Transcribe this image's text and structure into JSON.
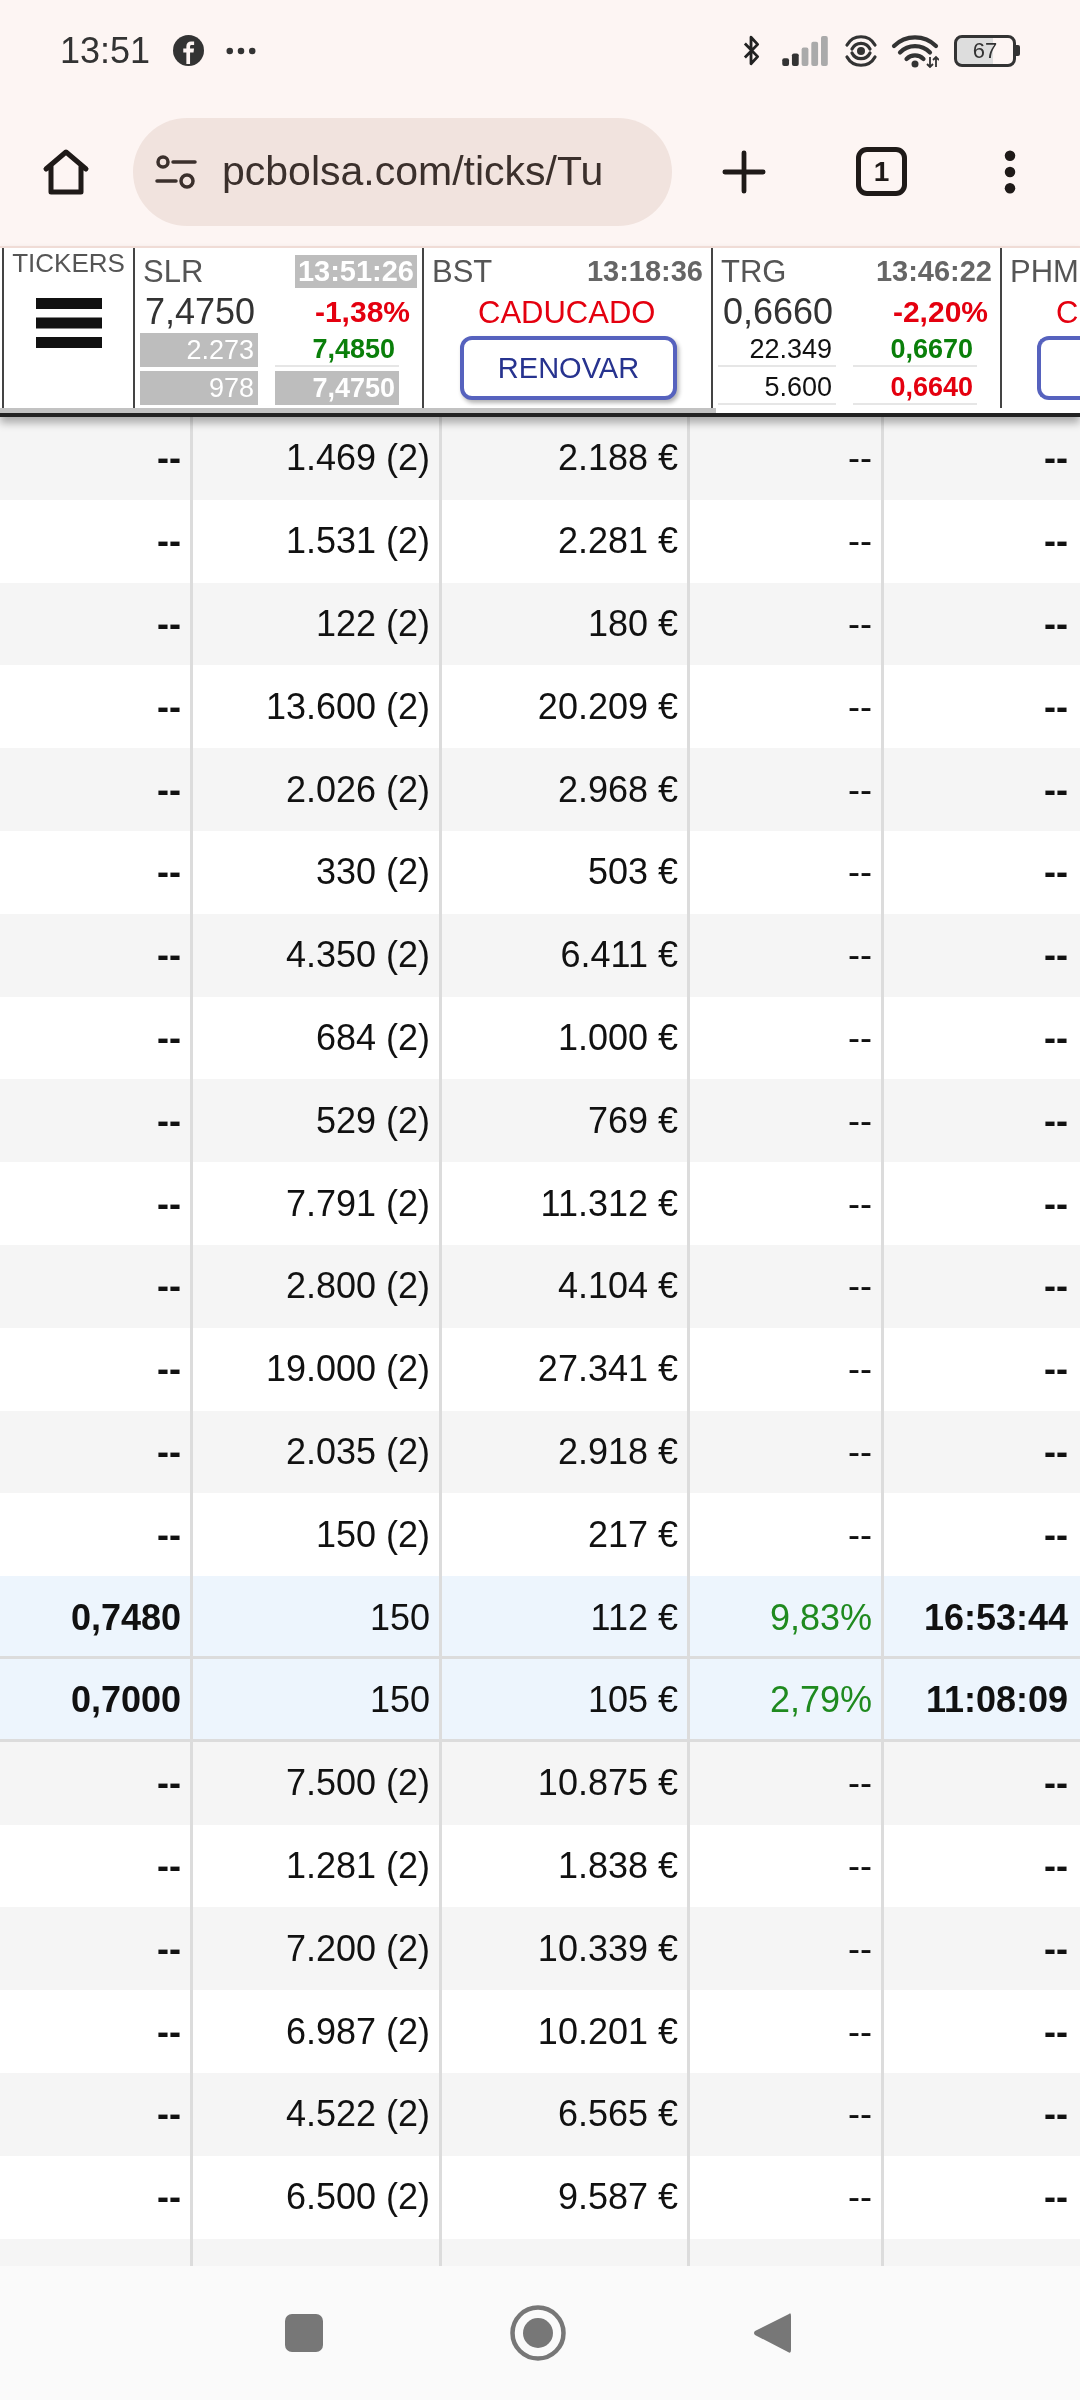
{
  "status_bar": {
    "time": "13:51",
    "battery": "67"
  },
  "browser": {
    "url": "pcbolsa.com/ticks/Tu",
    "tab_count": "1"
  },
  "ticker_panel": {
    "menu_label": "TICKERS",
    "tickers": [
      {
        "kind": "quote",
        "symbol": "SLR",
        "time": "13:51:26",
        "time_flash": true,
        "price": "7,4750",
        "change": "-1,38%",
        "rising": false,
        "bid_volume": {
          "text": "2.273",
          "flash": true
        },
        "bid": {
          "text": "7,4850",
          "flash": false
        },
        "ask_volume": {
          "text": "978",
          "flash": true
        },
        "ask": {
          "text": "7,4750",
          "flash": true
        }
      },
      {
        "kind": "expired",
        "symbol": "BST",
        "time": "13:18:36",
        "time_flash": false,
        "status": "CADUCADO",
        "button": "RENOVAR"
      },
      {
        "kind": "quote",
        "symbol": "TRG",
        "time": "13:46:22",
        "time_flash": false,
        "price": "0,6660",
        "change": "-2,20%",
        "rising": false,
        "bid_volume": {
          "text": "22.349",
          "flash": false
        },
        "bid": {
          "text": "0,6670",
          "flash": false
        },
        "ask_volume": {
          "text": "5.600",
          "flash": false
        },
        "ask": {
          "text": "0,6640",
          "flash": false
        }
      },
      {
        "kind": "expired",
        "symbol": "PHM",
        "status": "C"
      }
    ]
  },
  "table": {
    "rows": [
      {
        "cells": [
          "--",
          "1.469 (2)",
          "2.188 €",
          "--",
          "--"
        ],
        "highlighted": false
      },
      {
        "cells": [
          "--",
          "1.531 (2)",
          "2.281 €",
          "--",
          "--"
        ],
        "highlighted": false
      },
      {
        "cells": [
          "--",
          "122 (2)",
          "180 €",
          "--",
          "--"
        ],
        "highlighted": false
      },
      {
        "cells": [
          "--",
          "13.600 (2)",
          "20.209 €",
          "--",
          "--"
        ],
        "highlighted": false
      },
      {
        "cells": [
          "--",
          "2.026 (2)",
          "2.968 €",
          "--",
          "--"
        ],
        "highlighted": false
      },
      {
        "cells": [
          "--",
          "330 (2)",
          "503 €",
          "--",
          "--"
        ],
        "highlighted": false
      },
      {
        "cells": [
          "--",
          "4.350 (2)",
          "6.411 €",
          "--",
          "--"
        ],
        "highlighted": false
      },
      {
        "cells": [
          "--",
          "684 (2)",
          "1.000 €",
          "--",
          "--"
        ],
        "highlighted": false
      },
      {
        "cells": [
          "--",
          "529 (2)",
          "769 €",
          "--",
          "--"
        ],
        "highlighted": false
      },
      {
        "cells": [
          "--",
          "7.791 (2)",
          "11.312 €",
          "--",
          "--"
        ],
        "highlighted": false
      },
      {
        "cells": [
          "--",
          "2.800 (2)",
          "4.104 €",
          "--",
          "--"
        ],
        "highlighted": false
      },
      {
        "cells": [
          "--",
          "19.000 (2)",
          "27.341 €",
          "--",
          "--"
        ],
        "highlighted": false
      },
      {
        "cells": [
          "--",
          "2.035 (2)",
          "2.918 €",
          "--",
          "--"
        ],
        "highlighted": false
      },
      {
        "cells": [
          "--",
          "150 (2)",
          "217 €",
          "--",
          "--"
        ],
        "highlighted": false
      },
      {
        "cells": [
          "0,7480",
          "150",
          "112 €",
          "9,83%",
          "16:53:44"
        ],
        "highlighted": true
      },
      {
        "cells": [
          "0,7000",
          "150",
          "105 €",
          "2,79%",
          "11:08:09"
        ],
        "highlighted": true
      },
      {
        "cells": [
          "--",
          "7.500 (2)",
          "10.875 €",
          "--",
          "--"
        ],
        "highlighted": false
      },
      {
        "cells": [
          "--",
          "1.281 (2)",
          "1.838 €",
          "--",
          "--"
        ],
        "highlighted": false
      },
      {
        "cells": [
          "--",
          "7.200 (2)",
          "10.339 €",
          "--",
          "--"
        ],
        "highlighted": false
      },
      {
        "cells": [
          "--",
          "6.987 (2)",
          "10.201 €",
          "--",
          "--"
        ],
        "highlighted": false
      },
      {
        "cells": [
          "--",
          "4.522 (2)",
          "6.565 €",
          "--",
          "--"
        ],
        "highlighted": false
      },
      {
        "cells": [
          "--",
          "6.500 (2)",
          "9.587 €",
          "--",
          "--"
        ],
        "highlighted": false
      }
    ]
  }
}
